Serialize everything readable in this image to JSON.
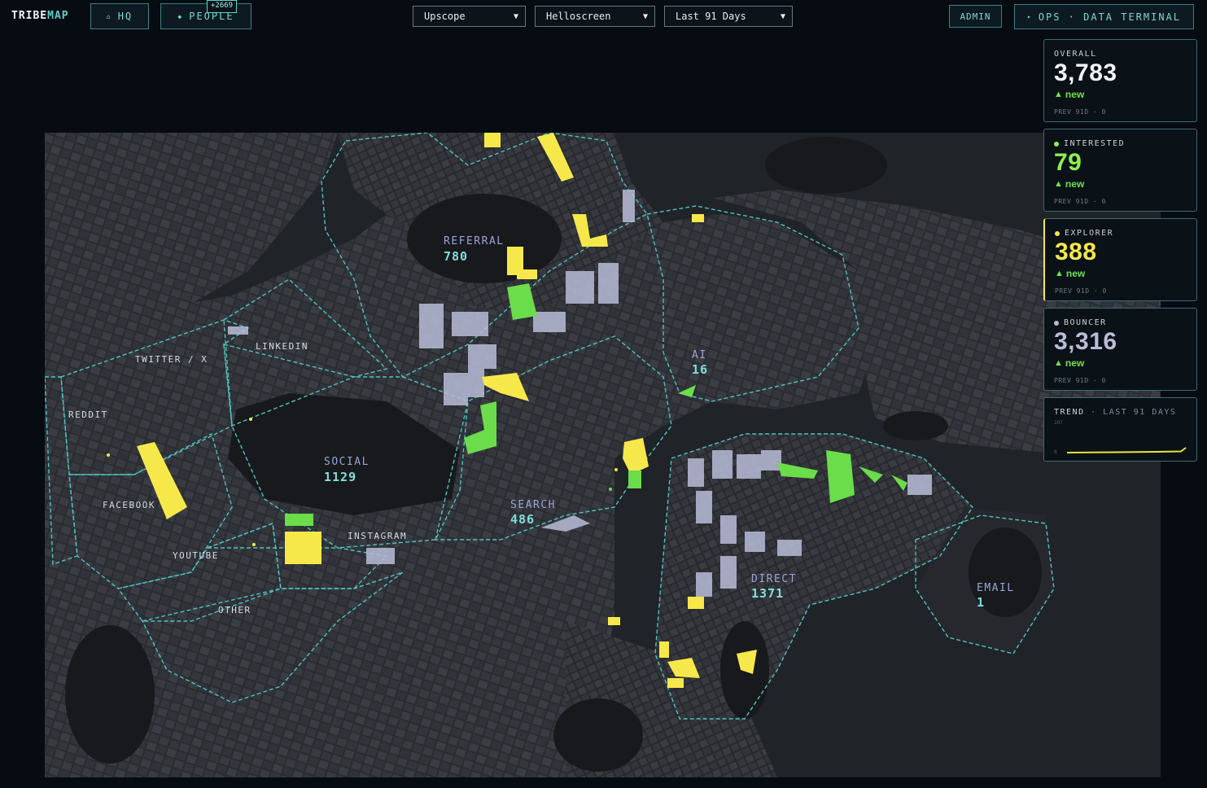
{
  "app": {
    "logo_main": "TRIBE",
    "logo_accent": "MAP"
  },
  "nav": {
    "hq_label": "HQ",
    "people_label": "PEOPLE",
    "people_badge": "+2669",
    "admin_label": "ADMIN",
    "terminal_label": "OPS · DATA TERMINAL"
  },
  "filters": {
    "workspace": "Upscope",
    "site": "Helloscreen",
    "range": "Last 91 Days"
  },
  "zones": {
    "referral": {
      "label": "REFERRAL",
      "count": "780"
    },
    "social": {
      "label": "SOCIAL",
      "count": "1129"
    },
    "search": {
      "label": "SEARCH",
      "count": "486"
    },
    "ai": {
      "label": "AI",
      "count": "16"
    },
    "direct": {
      "label": "DIRECT",
      "count": "1371"
    },
    "email": {
      "label": "EMAIL",
      "count": "1"
    },
    "twitter": {
      "label": "TWITTER / X"
    },
    "linkedin": {
      "label": "LINKEDIN"
    },
    "reddit": {
      "label": "REDDIT"
    },
    "facebook": {
      "label": "FACEBOOK"
    },
    "youtube": {
      "label": "YOUTUBE"
    },
    "instagram": {
      "label": "INSTAGRAM"
    },
    "other": {
      "label": "OTHER"
    }
  },
  "stats": {
    "overall": {
      "label": "OVERALL",
      "value": "3,783",
      "delta": "new",
      "prev": "PREV 91D · 0",
      "color": "#f2f5f7"
    },
    "interested": {
      "label": "INTERESTED",
      "value": "79",
      "delta": "new",
      "prev": "PREV 91D · 0",
      "color": "#8ef04e"
    },
    "explorer": {
      "label": "EXPLORER",
      "value": "388",
      "delta": "new",
      "prev": "PREV 91D · 0",
      "color": "#f6e84a"
    },
    "bouncer": {
      "label": "BOUNCER",
      "value": "3,316",
      "delta": "new",
      "prev": "PREV 91D · 0",
      "color": "#b8bdd8"
    }
  },
  "trend": {
    "label": "TREND",
    "sub": "· LAST 91 DAYS",
    "y_max": "107",
    "y_min": "0",
    "line_color": "#e6e83a"
  },
  "colors": {
    "accent": "#5fd0c8",
    "interested": "#8ef04e",
    "explorer": "#f6e84a",
    "bouncer": "#b8bdd8"
  }
}
